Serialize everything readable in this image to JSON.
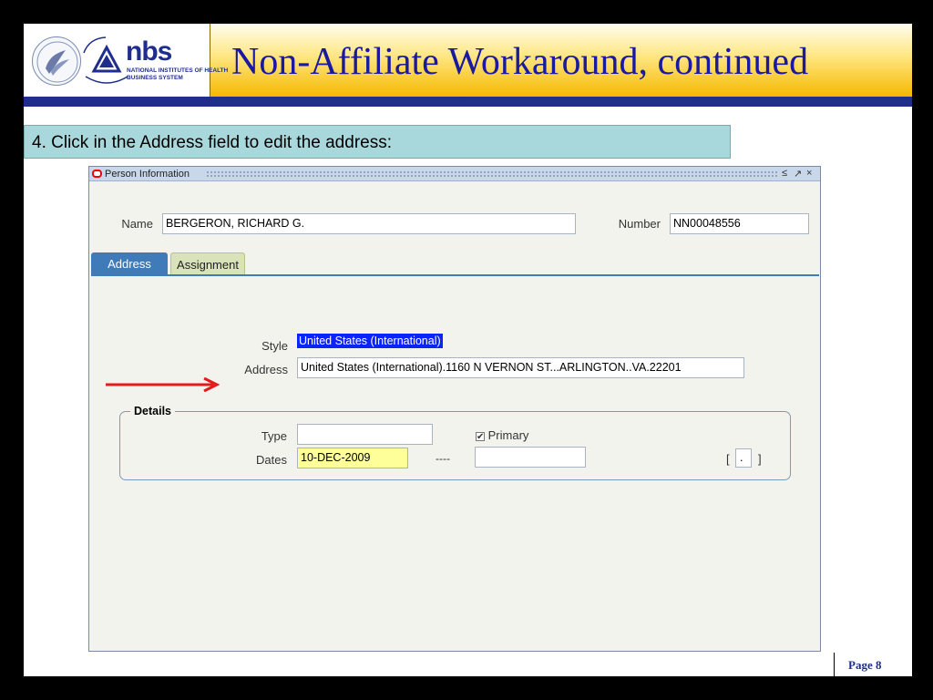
{
  "header": {
    "title": "Non-Affiliate Workaround, continued",
    "logo": {
      "name": "nbs",
      "subtitle_line1": "NATIONAL INSTITUTES OF HEALTH",
      "subtitle_line2": "BUSINESS SYSTEM",
      "icon": "nih-logo-icon"
    }
  },
  "instruction": "4.  Click in the Address field to edit the address:",
  "window": {
    "title": "Person Information",
    "controls": [
      "≤",
      "↗",
      "×"
    ],
    "name_label": "Name",
    "name_value": "BERGERON, RICHARD G.",
    "number_label": "Number",
    "number_value": "NN00048556",
    "tabs": [
      {
        "label": "Address",
        "active": true
      },
      {
        "label": "Assignment",
        "active": false
      }
    ],
    "style_label": "Style",
    "style_value": "United States (International)",
    "address_label": "Address",
    "address_value": "United States (International).1160 N VERNON ST...ARLINGTON..VA.22201",
    "details": {
      "legend": "Details",
      "type_label": "Type",
      "type_value": "",
      "primary_label": "Primary",
      "primary_checked": true,
      "dates_label": "Dates",
      "date_from": "10-DEC-2009",
      "date_separator": "----",
      "date_to": "",
      "flex_open": "[",
      "flex_value": ".",
      "flex_close": "]"
    }
  },
  "footer": {
    "page_label": "Page 8"
  },
  "colors": {
    "title": "#1a1aa0",
    "header_rule": "#1f2e8c",
    "instruction_bg": "#a8d8dc",
    "tab_active": "#3f7bb8",
    "selection": "#0b24fb",
    "arrow": "#e41b1b",
    "date_highlight": "#ffff99"
  }
}
